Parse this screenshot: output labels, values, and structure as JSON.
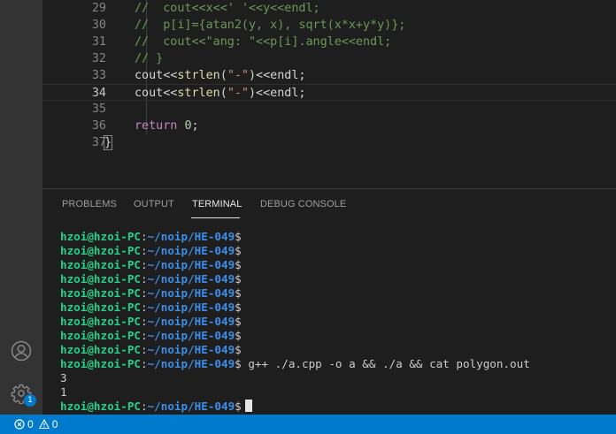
{
  "editor": {
    "lines": [
      {
        "num": "29",
        "tokens": [
          {
            "t": "//  cout<<x<<' '<<y<<endl;",
            "c": "c-comment"
          }
        ]
      },
      {
        "num": "30",
        "tokens": [
          {
            "t": "//  p[i]={atan2(y, x), sqrt(x*x+y*y)};",
            "c": "c-comment"
          }
        ]
      },
      {
        "num": "31",
        "tokens": [
          {
            "t": "//  cout<<\"ang: \"<<p[i].angle<<endl;",
            "c": "c-comment"
          }
        ]
      },
      {
        "num": "32",
        "tokens": [
          {
            "t": "// }",
            "c": "c-comment"
          }
        ]
      },
      {
        "num": "33",
        "tokens": [
          {
            "t": "cout<<",
            "c": "c-ident"
          },
          {
            "t": "strlen",
            "c": "c-func"
          },
          {
            "t": "(",
            "c": "c-ident"
          },
          {
            "t": "\"-\"",
            "c": "c-str"
          },
          {
            "t": ")<<endl;",
            "c": "c-ident"
          }
        ]
      },
      {
        "num": "34",
        "tokens": [
          {
            "t": "cout<<",
            "c": "c-ident"
          },
          {
            "t": "strlen",
            "c": "c-func"
          },
          {
            "t": "(",
            "c": "c-ident"
          },
          {
            "t": "\"-\"",
            "c": "c-str"
          },
          {
            "t": ")<<endl;",
            "c": "c-ident"
          }
        ]
      },
      {
        "num": "35",
        "tokens": []
      },
      {
        "num": "36",
        "tokens": [
          {
            "t": "return",
            "c": "c-kw"
          },
          {
            "t": " ",
            "c": "c-ident"
          },
          {
            "t": "0",
            "c": "c-num"
          },
          {
            "t": ";",
            "c": "c-ident"
          }
        ]
      },
      {
        "num": "37",
        "tokens": [
          {
            "t": "}",
            "c": "c-brace"
          }
        ]
      }
    ],
    "current_line": "34"
  },
  "panel": {
    "tabs": [
      {
        "label": "PROBLEMS"
      },
      {
        "label": "OUTPUT"
      },
      {
        "label": "TERMINAL"
      },
      {
        "label": "DEBUG CONSOLE"
      }
    ],
    "active_tab": "TERMINAL"
  },
  "terminal": {
    "user": "hzoi@hzoi-PC",
    "colon": ":",
    "path": "~/noip/HE-049",
    "prompt_symbol": "$",
    "lines": [
      {
        "type": "prompt",
        "cmd": ""
      },
      {
        "type": "prompt",
        "cmd": ""
      },
      {
        "type": "prompt",
        "cmd": ""
      },
      {
        "type": "prompt",
        "cmd": ""
      },
      {
        "type": "prompt",
        "cmd": ""
      },
      {
        "type": "prompt",
        "cmd": ""
      },
      {
        "type": "prompt",
        "cmd": ""
      },
      {
        "type": "prompt",
        "cmd": ""
      },
      {
        "type": "prompt",
        "cmd": ""
      },
      {
        "type": "prompt",
        "cmd": " g++ ./a.cpp -o a && ./a && cat polygon.out"
      },
      {
        "type": "output",
        "text": "3"
      },
      {
        "type": "output",
        "text": "1"
      },
      {
        "type": "prompt",
        "cmd": " ",
        "cursor": true
      }
    ]
  },
  "activity_bar": {
    "icons": [
      "account-icon",
      "manage-gear-icon"
    ],
    "update_badge": "1"
  },
  "status_bar": {
    "errors": "0",
    "warnings": "0"
  },
  "colors": {
    "status_bar_bg": "#007acc",
    "prompt_user": "#23d18b",
    "prompt_path": "#3b8eea"
  }
}
